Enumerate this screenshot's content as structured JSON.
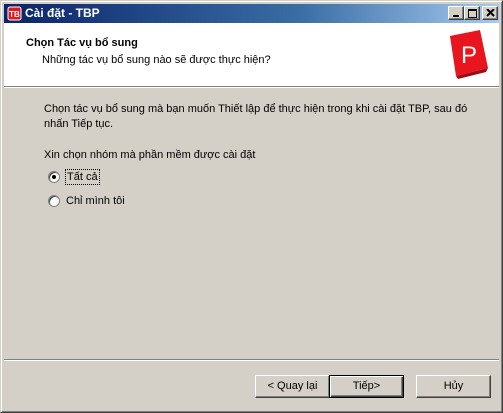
{
  "window": {
    "title": "Cài đặt - TBP",
    "icon": "tbp-app-icon"
  },
  "header": {
    "title": "Chọn Tác vụ bổ sung",
    "subtitle": "Những tác vụ bổ sung nào sẽ được thực hiện?",
    "logo_letter": "P",
    "logo_color": "#e8141e"
  },
  "body": {
    "description": "Chọn tác vụ bổ sung mà bạn muốn Thiết lập để thực hiện trong khi cài đặt TBP, sau đó nhấn Tiếp tục.",
    "group_label": "Xin chọn nhóm mà phần mềm được cài đặt",
    "options": [
      {
        "label": "Tất cả",
        "selected": true
      },
      {
        "label": "Chỉ mình tôi",
        "selected": false
      }
    ]
  },
  "buttons": {
    "back": "< Quay lại",
    "next": "Tiếp>",
    "cancel": "Hủy"
  },
  "colors": {
    "title_gradient_start": "#0a246a",
    "title_gradient_end": "#a6caf0",
    "face": "#d4d0c8"
  }
}
